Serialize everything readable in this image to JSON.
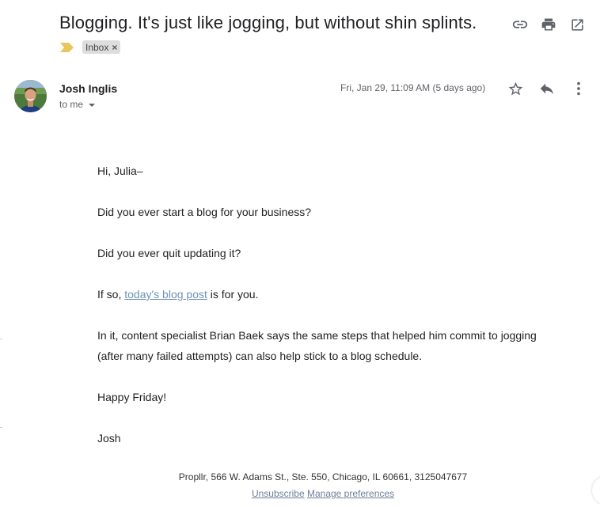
{
  "subject": "Blogging. It's just like jogging, but without shin splints.",
  "labels": {
    "inbox_label": "Inbox",
    "close_glyph": "×"
  },
  "sender": {
    "name": "Josh Inglis",
    "recipient_text": "to me"
  },
  "date": "Fri, Jan 29, 11:09 AM (5 days ago)",
  "body": {
    "greeting": "Hi, Julia–",
    "line1": "Did you ever start a blog for your business?",
    "line2": "Did you ever quit updating it?",
    "line3_before": "If so, ",
    "line3_link": "today's blog post",
    "line3_after": " is for you.",
    "line4": "In it, content specialist Brian Baek says the same steps that helped him commit to jogging (after many failed attempts) can also help stick to a blog schedule.",
    "line5": "Happy Friday!",
    "signoff": "Josh"
  },
  "footer": {
    "address": "Propllr, 566 W. Adams St., Ste. 550, Chicago, IL 60661, 3125047677",
    "unsubscribe": "Unsubscribe",
    "manage": "Manage preferences"
  },
  "icons": {
    "top": [
      "link-icon",
      "print-icon",
      "open-in-new-window-icon"
    ],
    "message": [
      "star-icon",
      "reply-icon",
      "more-vert-icon"
    ],
    "importance": "importance-marker-icon",
    "avatar": "avatar"
  },
  "colors": {
    "importance": "#e8c65a",
    "link": "#6f92b8",
    "chip_bg": "#dddddd",
    "icon": "#5f6368"
  }
}
